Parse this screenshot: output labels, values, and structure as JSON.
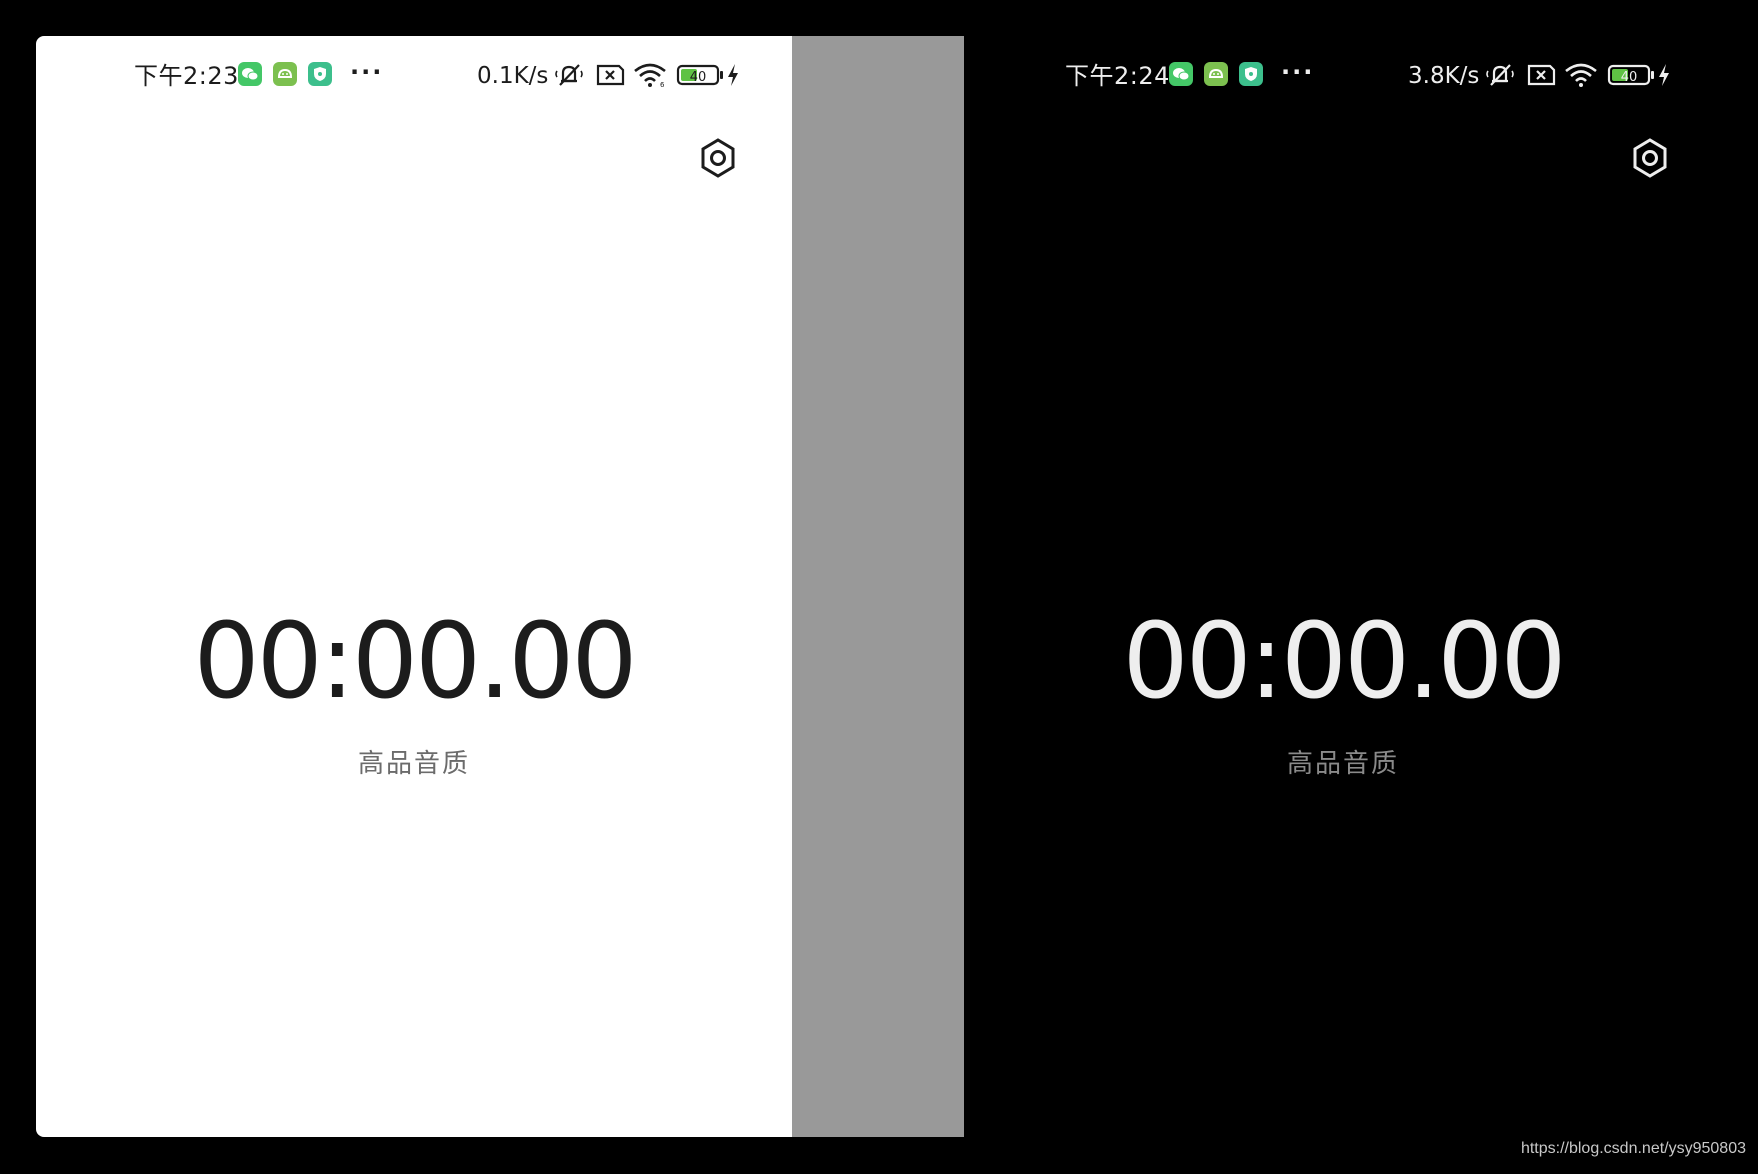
{
  "colors": {
    "background": "#000000",
    "light_screen_bg": "#ffffff",
    "divider_panel": "#999999",
    "dark_screen_bg": "#000000",
    "light_text": "#1c1c1c",
    "dark_text": "#eeeeee",
    "subtitle_light": "#6b6b6b",
    "subtitle_dark": "#8a8a8a",
    "app_wechat": "#44c767",
    "app_android": "#7cc04f",
    "app_shield": "#3cbf8c",
    "battery_fill": "#5fc244"
  },
  "light_screen": {
    "status_bar": {
      "time": "下午2:23",
      "app_icons": [
        "wechat-icon",
        "android-robot-icon",
        "shield-icon"
      ],
      "more": "···",
      "net_speed": "0.1K/s",
      "system_icons": [
        "muted-bell-icon",
        "sim-error-icon",
        "wifi-icon",
        "battery-icon",
        "charging-bolt-icon"
      ],
      "battery_level": "40"
    },
    "settings_icon": "gear-icon",
    "timer": "00:00.00",
    "quality_label": "高品音质"
  },
  "dark_screen": {
    "status_bar": {
      "time": "下午2:24",
      "app_icons": [
        "wechat-icon",
        "android-robot-icon",
        "shield-icon"
      ],
      "more": "···",
      "net_speed": "3.8K/s",
      "system_icons": [
        "muted-bell-icon",
        "sim-error-icon",
        "wifi-icon",
        "battery-icon",
        "charging-bolt-icon"
      ],
      "battery_level": "40"
    },
    "settings_icon": "gear-icon",
    "timer": "00:00.00",
    "quality_label": "高品音质"
  },
  "watermark": "https://blog.csdn.net/ysy950803"
}
